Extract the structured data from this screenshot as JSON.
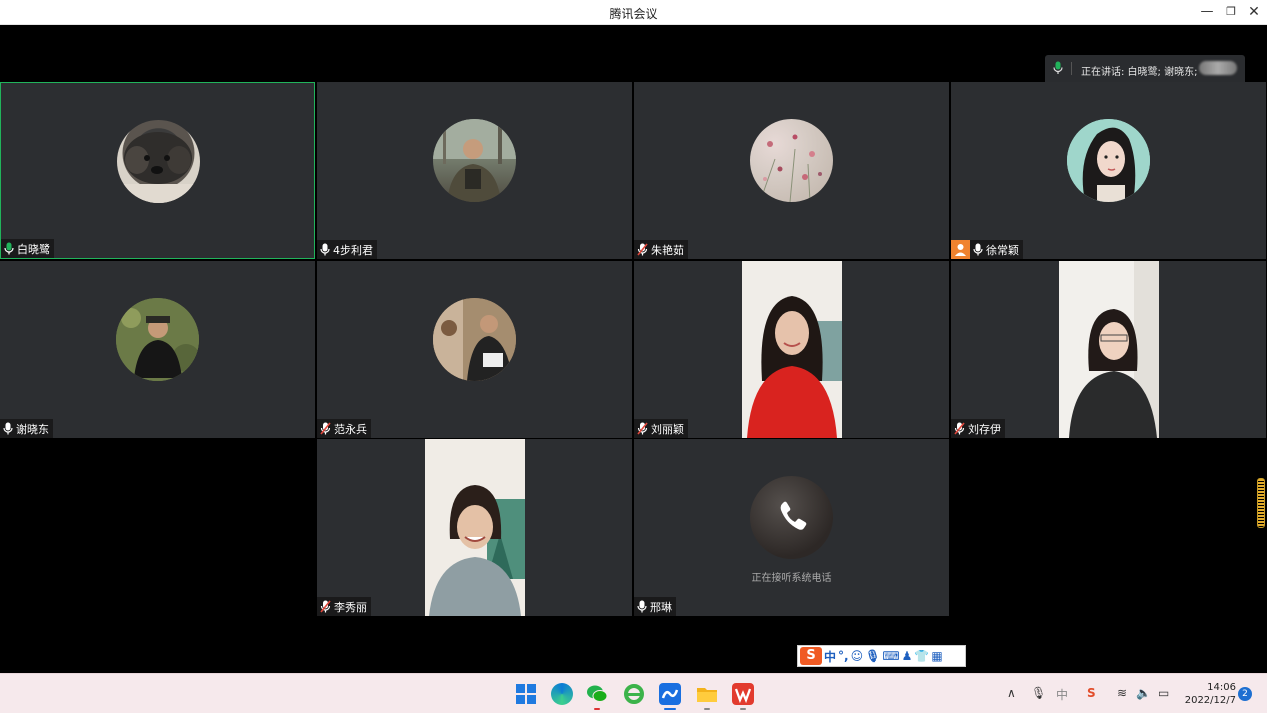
{
  "window": {
    "title": "腾讯会议",
    "minimize": "—",
    "maximize": "❐",
    "close": "✕"
  },
  "speaking": {
    "text": "正在讲话: 白晓鹭; 谢晓东;"
  },
  "participants": [
    {
      "name": "白晓鹭",
      "mic": "on-active"
    },
    {
      "name": "4步利君",
      "mic": "on"
    },
    {
      "name": "朱艳茹",
      "mic": "muted"
    },
    {
      "name": "徐常颖",
      "mic": "on",
      "host": true
    },
    {
      "name": "谢晓东",
      "mic": "on"
    },
    {
      "name": "范永兵",
      "mic": "muted"
    },
    {
      "name": "刘丽颖",
      "mic": "muted"
    },
    {
      "name": "刘存伊",
      "mic": "muted"
    },
    {
      "name": "李秀丽",
      "mic": "muted"
    },
    {
      "name": "邢琳",
      "mic": "on",
      "status": "正在接听系统电话"
    }
  ],
  "ime": {
    "mode": "中",
    "punct": "°,"
  },
  "taskbar": {
    "time": "14:06",
    "date": "2022/12/7",
    "notifications": "2",
    "ime_indicator": "中"
  },
  "colors": {
    "active_border": "#21b35b",
    "tile_bg": "#2c2e31",
    "mic_green": "#21b35b",
    "muted_red": "#e0473c",
    "host_orange": "#f0832f"
  }
}
